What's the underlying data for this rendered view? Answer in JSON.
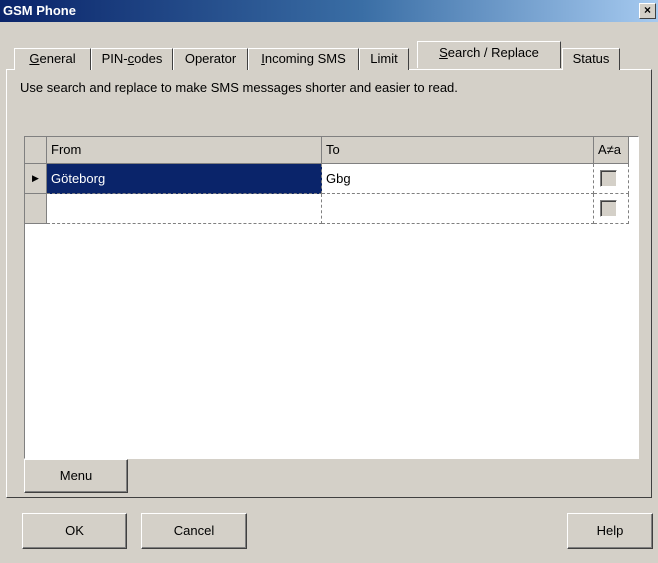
{
  "window": {
    "title": "GSM Phone",
    "close_glyph": "×"
  },
  "tabs": [
    {
      "label": "General",
      "mnemonic": "G",
      "rest": "eneral"
    },
    {
      "label": "PIN-codes",
      "pre": "PIN-",
      "mnemonic": "c",
      "rest": "odes"
    },
    {
      "label": "Operator"
    },
    {
      "label": "Incoming SMS",
      "mnemonic": "I",
      "rest": "ncoming SMS"
    },
    {
      "label": "Limit"
    },
    {
      "label": "Search / Replace",
      "mnemonic": "S",
      "rest": "earch / Replace",
      "active": true
    },
    {
      "label": "Status"
    }
  ],
  "description": "Use search and replace to make SMS messages shorter and easier to read.",
  "grid": {
    "columns": {
      "from": "From",
      "to": "To",
      "case": "A≠a"
    },
    "rows": [
      {
        "indicator": "▶",
        "from": "Göteborg",
        "to": "Gbg",
        "case_sensitive": false
      },
      {
        "indicator": "",
        "from": "",
        "to": "",
        "case_sensitive": false
      }
    ]
  },
  "buttons": {
    "menu": "Menu",
    "ok": "OK",
    "cancel": "Cancel",
    "help": "Help"
  },
  "colors": {
    "selection": "#0a246a",
    "face": "#d4d0c8",
    "title_start": "#0a246a",
    "title_end": "#a6caf0"
  }
}
